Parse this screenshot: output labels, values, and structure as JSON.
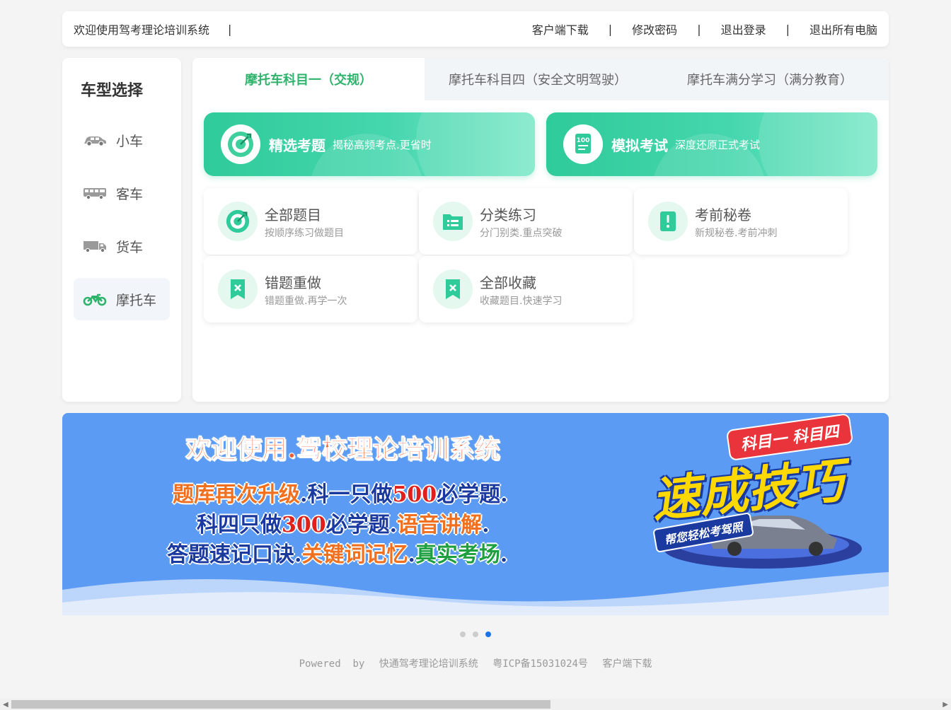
{
  "topbar": {
    "welcome": "欢迎使用驾考理论培训系统",
    "sep": "|",
    "links": [
      "客户端下载",
      "修改密码",
      "退出登录",
      "退出所有电脑"
    ]
  },
  "sidebar": {
    "title": "车型选择",
    "vehicles": [
      {
        "label": "小车",
        "icon": "car-icon",
        "active": false
      },
      {
        "label": "客车",
        "icon": "bus-icon",
        "active": false
      },
      {
        "label": "货车",
        "icon": "truck-icon",
        "active": false
      },
      {
        "label": "摩托车",
        "icon": "motorcycle-icon",
        "active": true
      }
    ]
  },
  "tabs": [
    {
      "label": "摩托车科目一（交规）",
      "active": true
    },
    {
      "label": "摩托车科目四（安全文明驾驶）",
      "active": false
    },
    {
      "label": "摩托车满分学习（满分教育）",
      "active": false
    }
  ],
  "hero": [
    {
      "title": "精选考题",
      "subtitle": "揭秘高频考点.更省时",
      "icon": "target-icon"
    },
    {
      "title": "模拟考试",
      "subtitle": "深度还原正式考试",
      "icon": "exam-100-icon",
      "icon_text": "100"
    }
  ],
  "cards": [
    {
      "title": "全部题目",
      "subtitle": "按顺序练习做题目",
      "icon": "target-icon"
    },
    {
      "title": "分类练习",
      "subtitle": "分门别类.重点突破",
      "icon": "folder-list-icon"
    },
    {
      "title": "考前秘卷",
      "subtitle": "新规秘卷.考前冲刺",
      "icon": "alert-doc-icon"
    },
    {
      "title": "错题重做",
      "subtitle": "错题重做.再学一次",
      "icon": "bookmark-x-icon"
    },
    {
      "title": "全部收藏",
      "subtitle": "收藏题目.快速学习",
      "icon": "bookmark-x-icon"
    }
  ],
  "banner": {
    "title": "欢迎使用.驾校理论培训系统",
    "line1": {
      "a": "题库再次升级",
      "b": ".科一只做",
      "c": "500",
      "d": "必学题."
    },
    "line2": {
      "a": "科四只做",
      "b": "300",
      "c": "必学题",
      "d": ".",
      "e": "语音讲解",
      "f": "."
    },
    "line3": {
      "a": "答题速记口诀",
      "b": ".",
      "c": "关键词记忆",
      "d": ".",
      "e": "真实考场",
      "f": "."
    },
    "promo_tag": "科目一 科目四",
    "promo_big": "速成技巧",
    "promo_sub": "帮您轻松考驾照",
    "colors": {
      "bg": "#5b9bf3",
      "orange": "#f07020",
      "blue": "#1a3aa0",
      "red": "#e0201a",
      "green": "#1ea040"
    }
  },
  "carousel": {
    "count": 3,
    "active_index": 2
  },
  "footer": {
    "powered": "Powered  by",
    "system": "快通驾考理论培训系统",
    "icp": "粤ICP备15031024号",
    "download": "客户端下载"
  },
  "colors": {
    "accent": "#2fb36c",
    "hero_gradient_start": "#2fcb9a",
    "hero_gradient_end": "#7ee8c9"
  }
}
